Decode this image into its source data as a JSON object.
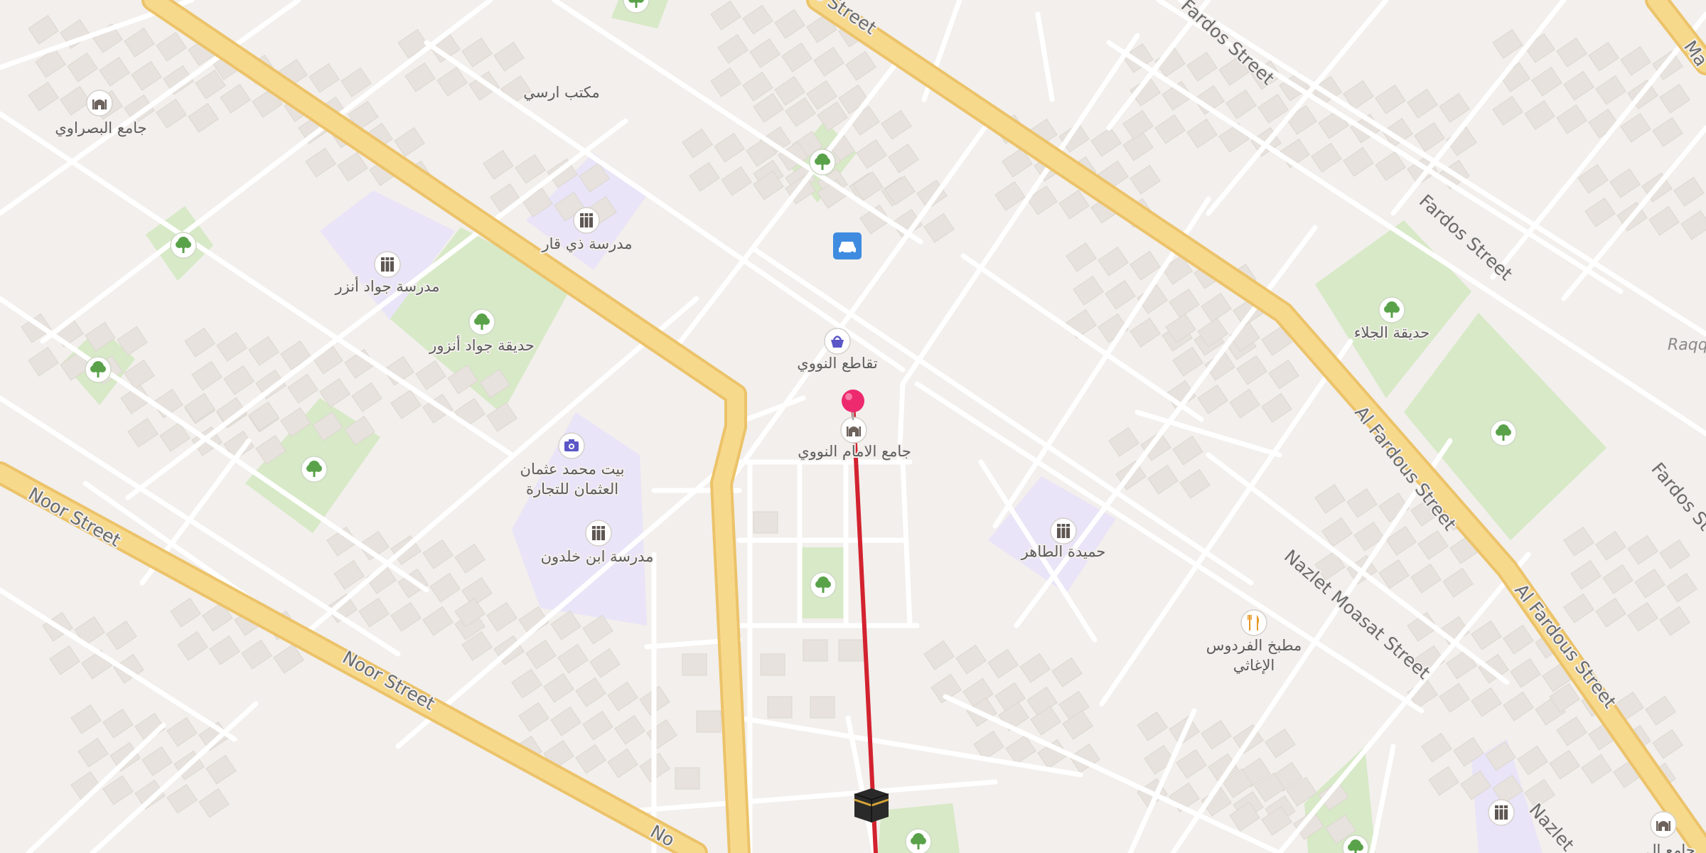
{
  "map": {
    "colors": {
      "background": "#f2efec",
      "building": "#e7e2dd",
      "building_stroke": "#ddd7d1",
      "minor_road": "#ffffff",
      "major_road_fill": "#f7d98c",
      "major_road_casing": "#ecc36a",
      "park": "#d7e9c6",
      "school": "#e9e4f7",
      "route_line": "#d3222f",
      "pin": "#ee2a6f",
      "label": "#5c5c5c",
      "street_label": "#6b6b6b",
      "italic_label": "#8a8a8a"
    },
    "street_labels": {
      "noor_street_1": "Noor Street",
      "noor_street_2": "Noor Street",
      "noor_street_3": "No",
      "fardos_street_1": "Fardos Street",
      "fardos_street_2": "Fardos Street",
      "fardos_street_3": "Fardos St",
      "al_fardous_1": "Al Fardous Street",
      "al_fardous_2": "Al Fardous Street",
      "nazlet_1": "Nazlet Moasat Street",
      "nazlet_2": "Nazlet",
      "top_street": "s Street",
      "top_right_ma": "Ma",
      "raqq": "Raqq"
    },
    "places": {
      "p_basrawi": "جامع البصراوي",
      "p_office": "مكتب ارسي",
      "p_school_dhiqar": "مدرسة ذي قار",
      "p_school_jawad": "مدرسة جواد أنزر",
      "p_garden_jawad": "حديقة جواد أنزور",
      "p_nawawi_intersection": "تقاطع النووي",
      "p_nawawi_mosque": "جامع الامام النووي",
      "p_house_trade_1": "بيت محمد عثمان",
      "p_house_trade_2": "العثمان للتجارة",
      "p_school_khaldun": "مدرسة ابن خلدون",
      "p_taher": "حميدة الطاهر",
      "p_garden_jala": "حديقة الجلاء",
      "p_kitchen_1": "مطبخ الفردوس",
      "p_kitchen_2": "الإغاثي",
      "p_bottom_right": "جامع ال"
    },
    "icons": {
      "mosque": "mosque-icon",
      "tree": "tree-icon",
      "school": "school-icon",
      "car": "car-icon",
      "shop": "shopping-basket-icon",
      "camera": "camera-icon",
      "restaurant": "restaurant-icon",
      "kaaba": "kaaba-icon",
      "pin": "location-pin-icon"
    }
  }
}
